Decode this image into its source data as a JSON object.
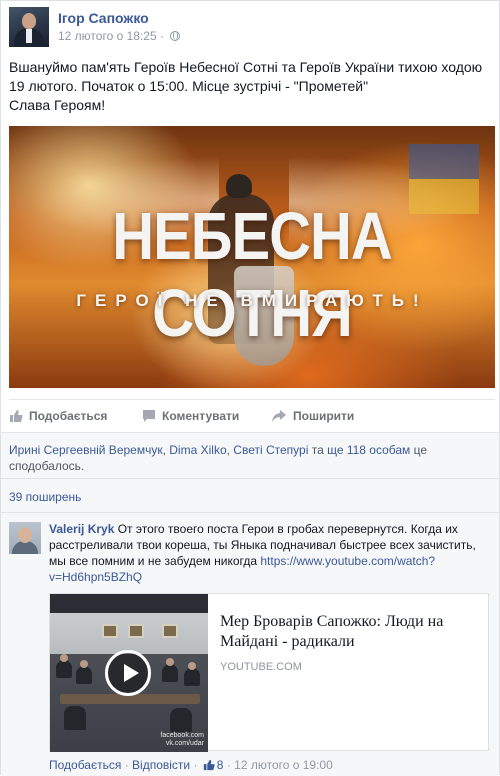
{
  "post": {
    "author": "Ігор Сапожко",
    "timestamp": "12 лютого о 18:25 ·",
    "privacy_icon": "globe-icon",
    "text_lines": [
      "Вшануймо пам'ять Героїв Небесної Сотні та Героїв України тихою ходою",
      "19 лютого. Початок о 15:00. Місце зустрічі - \"Прометей\"",
      "Слава Героям!"
    ],
    "image": {
      "title": "НЕБЕСНА СОТНЯ",
      "subtitle": "ГЕРОЇ НЕ ВМИРАЮТЬ!"
    }
  },
  "actions": {
    "like": "Подобається",
    "comment": "Коментувати",
    "share": "Поширити"
  },
  "likes": {
    "name1": "Ирині Сергеевній Веремчук",
    "sep1": ", ",
    "name2": "Dima Xilko",
    "sep2": ", ",
    "name3": "Светі Степурі",
    "mid": " та ",
    "others": "ще 118 особам",
    "tail": " це",
    "line2": "сподобалось."
  },
  "shares": {
    "count_text": "39 поширень"
  },
  "comment": {
    "author": "Valerij Kryk",
    "line1": " От этого твоего поста Герои в гробах перевернутся. Когда их",
    "line2": "расстреливали твои кореша, ты Яныка подначивал быстрее всех зачистить,",
    "line3_text": "мы все помним и не забудем никогда ",
    "link_part1": "https://www.youtube.com/watch?",
    "link_part2": "v=Hd6hpn5BZhQ",
    "preview": {
      "title": "Мер Броварів Сапожко: Люди на Майдані - радикали",
      "domain": "YOUTUBE.COM",
      "watermark_line1": "facebook.com",
      "watermark_line2": "vk.com/udar"
    },
    "footer": {
      "like": "Подобається",
      "dot1": " · ",
      "reply": "Відповісти",
      "dot2": " · ",
      "like_count": "8",
      "dot3": " · ",
      "time": "12 лютого о 19:00"
    }
  }
}
